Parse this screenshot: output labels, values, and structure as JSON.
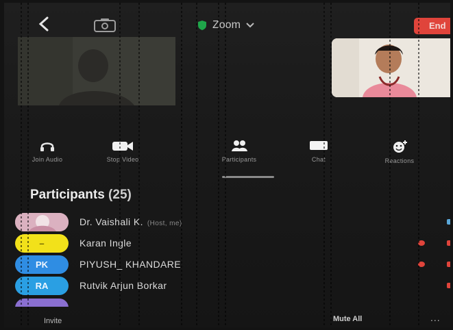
{
  "top_bar": {
    "back_icon": "chevron-left-icon",
    "camera_icon": "camera-switch-icon",
    "meeting_title": "Zoom",
    "end_label": "End"
  },
  "toolbar": {
    "items": [
      {
        "label": "Join Audio",
        "icon": "headphones-icon"
      },
      {
        "label": "Stop Video",
        "icon": "video-camera-icon"
      },
      {
        "label": "Participants",
        "icon": "participants-icon"
      },
      {
        "label": "Chat",
        "icon": "chat-icon"
      },
      {
        "label": "Reactions",
        "icon": "smiley-icon"
      }
    ]
  },
  "participants": {
    "heading": "Participants",
    "count": "(25)",
    "list": [
      {
        "initials": "",
        "name": "Dr. Vaishali K.",
        "role": "(Host, me)",
        "avatar_color": "#d9a7b8"
      },
      {
        "initials": "",
        "name": "Karan Ingle",
        "role": "",
        "avatar_color": "#f2e11a"
      },
      {
        "initials": "PK",
        "name": "PIYUSH_ KHANDARE",
        "role": "",
        "avatar_color": "#2f8de3"
      },
      {
        "initials": "RA",
        "name": "Rutvik Arjun Borkar",
        "role": "",
        "avatar_color": "#2a9fe3"
      },
      {
        "initials": "",
        "name": "",
        "role": "",
        "avatar_color": "#8a6fd0"
      }
    ]
  },
  "bottom_bar": {
    "invite_label": "Invite",
    "mute_all_label": "Mute All",
    "more_label": "..."
  },
  "colors": {
    "end_button": "#e0443b",
    "status_red": "#e0443b",
    "shield_green": "#1fa64a"
  }
}
